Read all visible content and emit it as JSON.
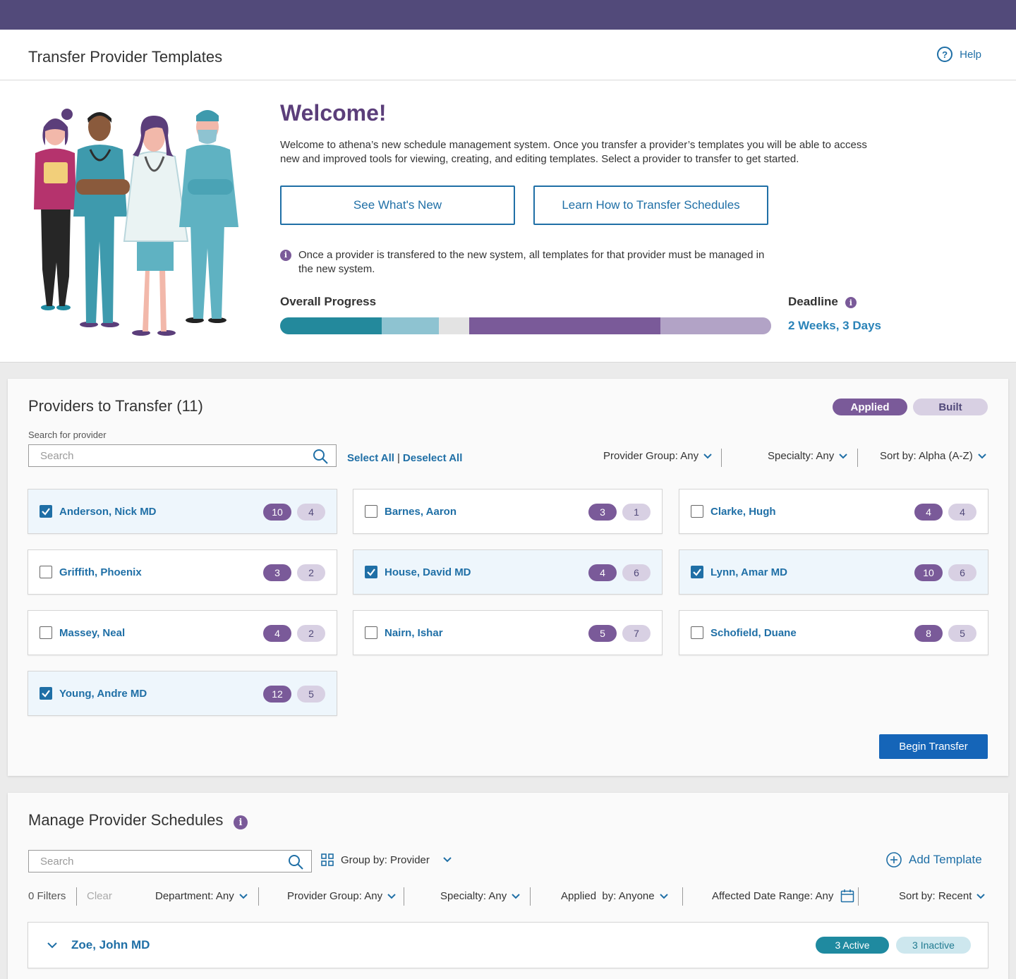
{
  "header": {
    "title": "Transfer Provider Templates",
    "help_label": "Help"
  },
  "welcome": {
    "title": "Welcome!",
    "text": "Welcome to athena’s new schedule management system. Once you transfer a provider’s templates you will be able to access new and improved tools for viewing, creating, and editing templates. Select a provider to transfer to get started.",
    "btn_whats_new": "See What's New",
    "btn_learn": "Learn How to Transfer Schedules",
    "note": "Once a provider is transfered to the new system, all templates for that provider must be managed in the new system.",
    "progress_label": "Overall Progress",
    "progress_segments": [
      {
        "fraction": 0.207,
        "color": "#23899c"
      },
      {
        "fraction": 0.117,
        "color": "#8ec3d1"
      },
      {
        "fraction": 0.061,
        "color": "#e3e3e3"
      },
      {
        "fraction": 0.389,
        "color": "#7a5a99"
      },
      {
        "fraction": 0.226,
        "color": "#b2a3c6"
      }
    ],
    "deadline_label": "Deadline",
    "deadline_value": "2 Weeks, 3 Days"
  },
  "transfer": {
    "title": "Providers to Transfer (11)",
    "toggle_applied": "Applied",
    "toggle_built": "Built",
    "search_label": "Search for provider",
    "search_placeholder": "Search",
    "select_all": "Select All",
    "deselect_all": "Deselect All",
    "filter_group": "Provider Group: Any",
    "filter_specialty": "Specialty: Any",
    "filter_sort": "Sort by: Alpha (A-Z)",
    "providers": [
      {
        "name": "Anderson, Nick MD",
        "checked": true,
        "applied": "10",
        "built": "4"
      },
      {
        "name": "Barnes, Aaron",
        "checked": false,
        "applied": "3",
        "built": "1"
      },
      {
        "name": "Clarke, Hugh",
        "checked": false,
        "applied": "4",
        "built": "4"
      },
      {
        "name": "Griffith, Phoenix",
        "checked": false,
        "applied": "3",
        "built": "2"
      },
      {
        "name": "House, David MD",
        "checked": true,
        "applied": "4",
        "built": "6"
      },
      {
        "name": "Lynn, Amar MD",
        "checked": true,
        "applied": "10",
        "built": "6"
      },
      {
        "name": "Massey, Neal",
        "checked": false,
        "applied": "4",
        "built": "2"
      },
      {
        "name": "Nairn, Ishar",
        "checked": false,
        "applied": "5",
        "built": "7"
      },
      {
        "name": "Schofield, Duane",
        "checked": false,
        "applied": "8",
        "built": "5"
      },
      {
        "name": "Young, Andre MD",
        "checked": true,
        "applied": "12",
        "built": "5"
      }
    ],
    "begin_label": "Begin Transfer"
  },
  "manage": {
    "title": "Manage Provider Schedules",
    "search_placeholder": "Search",
    "group_by": "Group by: Provider",
    "add_template": "Add Template",
    "filters_count": "0 Filters",
    "clear": "Clear",
    "filter_department": "Department: Any",
    "filter_group": "Provider Group: Any",
    "filter_specialty": "Specialty: Any",
    "filter_applied_by": "Applied  by: Anyone",
    "filter_date_range": "Affected Date Range: Any",
    "filter_sort": "Sort by: Recent",
    "rows": [
      {
        "name": "Zoe, John MD",
        "active": "3 Active",
        "inactive": "3 Inactive"
      }
    ]
  },
  "colors": {
    "topbar": "#524a7a",
    "accent_blue": "#1f6fa6",
    "purple": "#7a5a99",
    "teal": "#1f8aa0"
  }
}
